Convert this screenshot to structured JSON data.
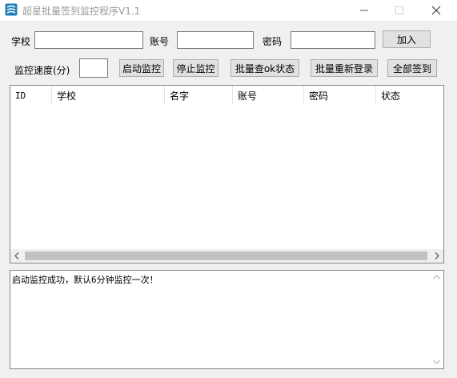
{
  "window": {
    "title": "超星批量签到监控程序V1.1"
  },
  "icons": {
    "app": "app-icon",
    "minimize": "minimize-icon",
    "maximize": "maximize-icon",
    "close": "close-icon"
  },
  "form": {
    "school_label": "学校",
    "school_value": "",
    "account_label": "账号",
    "account_value": "",
    "password_label": "密码",
    "password_value": "",
    "add_button": "加入",
    "speed_label": "监控速度(分)",
    "speed_value": ""
  },
  "toolbar": {
    "start_monitor": "启动监控",
    "stop_monitor": "停止监控",
    "batch_check_ok": "批量查ok状态",
    "batch_relogin": "批量重新登录",
    "sign_all": "全部签到"
  },
  "table": {
    "columns": [
      "ID",
      "学校",
      "名字",
      "账号",
      "密码",
      "状态"
    ],
    "rows": []
  },
  "log": {
    "text": "启动监控成功，默认6分钟监控一次！"
  },
  "colors": {
    "accent_icon": "#1e7fb8",
    "title_text": "#9a9a9a",
    "button_face": "#e1e1e1",
    "button_border": "#adadad"
  }
}
